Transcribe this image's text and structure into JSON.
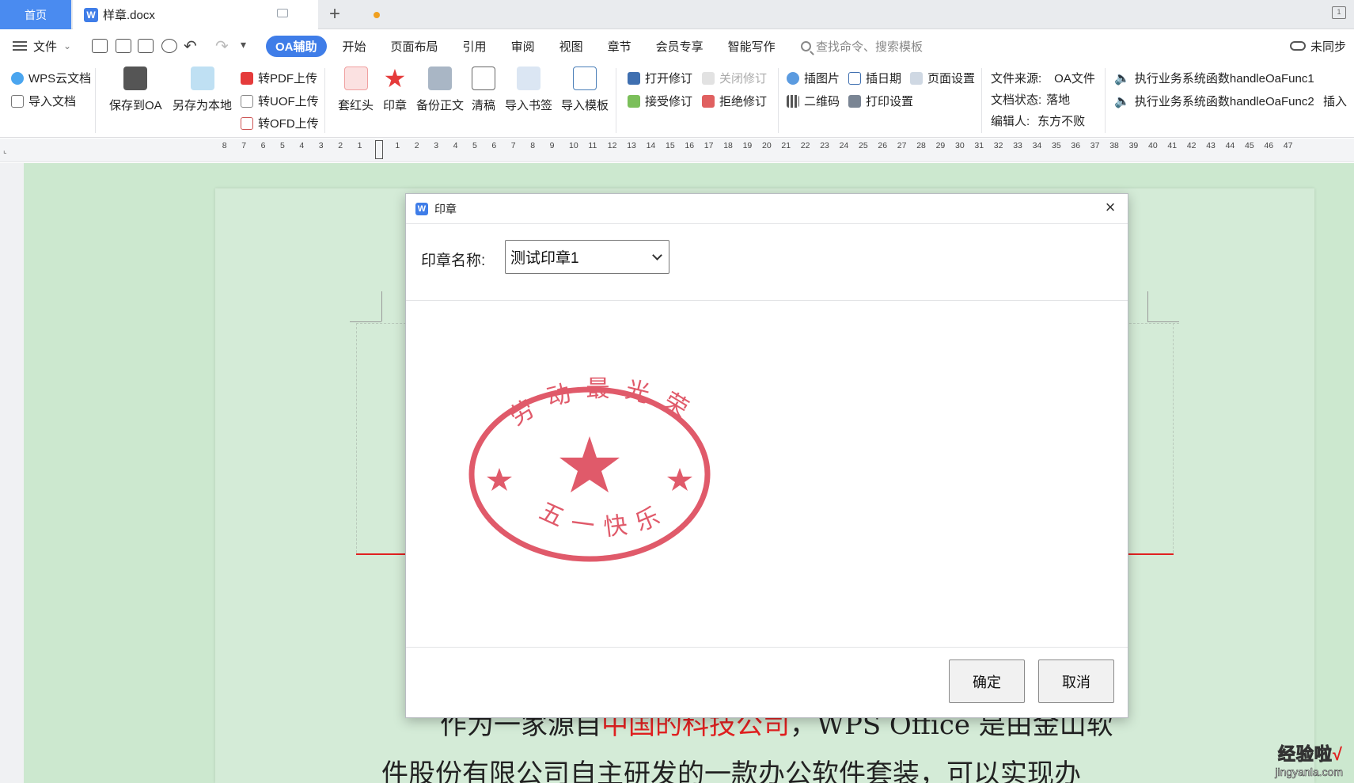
{
  "tabbar": {
    "home_tab": "首页",
    "doc_tab": "样章.docx",
    "new_tab_glyph": "+"
  },
  "menubar": {
    "file_label": "文件",
    "tabs": [
      "OA辅助",
      "开始",
      "页面布局",
      "引用",
      "审阅",
      "视图",
      "章节",
      "会员专享",
      "智能写作"
    ],
    "search_placeholder": "查找命令、搜索模板",
    "sync_label": "未同步"
  },
  "ribbon": {
    "wps_cloud": "WPS云文档",
    "import_doc": "导入文档",
    "save_to_oa": "保存到OA",
    "save_local": "另存为本地",
    "to_pdf": "转PDF上传",
    "to_uof": "转UOF上传",
    "to_ofd": "转OFD上传",
    "red_header": "套红头",
    "seal": "印章",
    "backup_body": "备份正文",
    "clean_draft": "清稿",
    "import_bookmark": "导入书签",
    "import_template": "导入模板",
    "open_revision": "打开修订",
    "close_revision": "关闭修订",
    "accept_revision": "接受修订",
    "reject_revision": "拒绝修订",
    "insert_picture": "插图片",
    "insert_date": "插日期",
    "page_setup": "页面设置",
    "qr_code": "二维码",
    "print_setup": "打印设置",
    "file_source_label": "文件来源:",
    "file_source_value": "OA文件",
    "doc_status_label": "文档状态:",
    "doc_status_value": "落地",
    "editor_label": "编辑人:",
    "editor_value": "东方不败",
    "func1": "执行业务系统函数handleOaFunc1",
    "func2": "执行业务系统函数handleOaFunc2",
    "insert_more": "插入"
  },
  "ruler": {
    "left_numbers": [
      "8",
      "7",
      "6",
      "5",
      "4",
      "3",
      "2",
      "1"
    ],
    "right_numbers": [
      "1",
      "2",
      "3",
      "4",
      "5",
      "6",
      "7",
      "8",
      "9",
      "10",
      "11",
      "12",
      "13",
      "14",
      "15",
      "16",
      "17",
      "18",
      "19",
      "20",
      "21",
      "22",
      "23",
      "24",
      "25",
      "26",
      "27",
      "28",
      "29",
      "30",
      "31",
      "32",
      "33",
      "34",
      "35",
      "36",
      "37",
      "38",
      "39",
      "40",
      "41",
      "42",
      "43",
      "44",
      "45",
      "46",
      "47"
    ]
  },
  "document": {
    "line1_a": "作为一家源自",
    "line1_red": "中国的科技公司",
    "line1_b": "，WPS Office 是由金山软",
    "line2": "件股份有限公司自主研发的一款办公软件套装，可以实现办"
  },
  "dialog": {
    "title": "印章",
    "close_glyph": "×",
    "seal_name_label": "印章名称:",
    "seal_name_value": "测试印章1",
    "seal_top_text": "劳动最光荣",
    "seal_bottom_text": "五一快乐",
    "ok_button": "确定",
    "cancel_button": "取消"
  },
  "watermark": {
    "line1": "经验啦",
    "check": "√",
    "line2": "jingyanla.com"
  },
  "colors": {
    "accent": "#3f7de8",
    "seal_red": "#e05a6a",
    "page_green": "#cce8cf",
    "rule_red": "#e02020"
  }
}
